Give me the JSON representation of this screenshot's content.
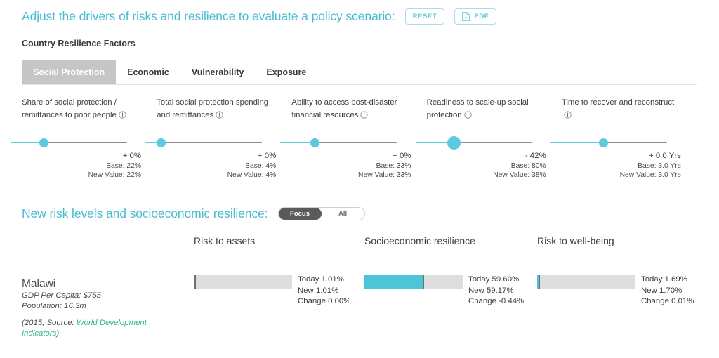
{
  "header": {
    "title": "Adjust the drivers of risks and resilience to evaluate a policy scenario:",
    "reset_label": "RESET",
    "pdf_label": "PDF",
    "reset_icon": "reset-icon",
    "pdf_icon": "pdf-download-icon",
    "accent_color": "#49bcd3"
  },
  "factors_section": {
    "label": "Country Resilience Factors",
    "tabs": [
      {
        "label": "Social Protection",
        "active": true
      },
      {
        "label": "Economic",
        "active": false
      },
      {
        "label": "Vulnerability",
        "active": false
      },
      {
        "label": "Exposure",
        "active": false
      }
    ]
  },
  "sliders": [
    {
      "label": "Share of social protection / remittances to poor people",
      "info_icon": "info-icon",
      "delta": "+ 0%",
      "base": "Base: 22%",
      "new_value": "New Value: 22%",
      "thumb_pct": 18,
      "thumb_size": 13
    },
    {
      "label": "Total social protection spending and remittances",
      "info_icon": "info-icon",
      "delta": "+ 0%",
      "base": "Base: 4%",
      "new_value": "New Value: 4%",
      "thumb_pct": 0,
      "thumb_size": 13
    },
    {
      "label": "Ability to access post-disaster financial resources",
      "info_icon": "info-icon",
      "delta": "+ 0%",
      "base": "Base: 33%",
      "new_value": "New Value: 33%",
      "thumb_pct": 19,
      "thumb_size": 13
    },
    {
      "label": "Readiness to scale-up social protection",
      "info_icon": "info-icon",
      "delta": "- 42%",
      "base": "Base: 80%",
      "new_value": "New Value: 38%",
      "thumb_pct": 23,
      "thumb_size": 19
    },
    {
      "label": "Time to recover and reconstruct",
      "info_icon": "info-icon",
      "delta": "+ 0.0 Yrs",
      "base": "Base: 3.0 Yrs",
      "new_value": "New Value: 3.0 Yrs",
      "thumb_pct": 37,
      "thumb_size": 13
    }
  ],
  "results_section": {
    "title": "New risk levels and socioeconomic resilience:",
    "toggle": {
      "focus_label": "Focus",
      "all_label": "All",
      "selected": "Focus"
    },
    "columns": [
      {
        "label": "Risk to assets"
      },
      {
        "label": "Socioeconomic resilience"
      },
      {
        "label": "Risk to well-being"
      }
    ]
  },
  "country": {
    "name": "Malawi",
    "gdp": "GDP Per Capita: $755",
    "population": "Population: 16.3m",
    "source_prefix": "(2015, Source: ",
    "source_link": "World Development Indicators",
    "source_suffix": ")",
    "link_color": "#2fb783"
  },
  "chart_data": {
    "type": "bar",
    "title": "New risk levels and socioeconomic resilience",
    "categories": [
      "Risk to assets",
      "Socioeconomic resilience",
      "Risk to well-being"
    ],
    "series": [
      {
        "name": "Today",
        "values": [
          1.01,
          59.6,
          1.69
        ]
      },
      {
        "name": "New",
        "values": [
          1.01,
          59.17,
          1.7
        ]
      },
      {
        "name": "Change",
        "values": [
          0.0,
          -0.44,
          0.01
        ]
      }
    ],
    "ylim": [
      0,
      100
    ],
    "unit": "%",
    "grid": false,
    "legend": "none",
    "bars": [
      {
        "category": "Risk to assets",
        "fill_pct": 1.01,
        "marker_pct": 1.01,
        "today_label": "Today 1.01%",
        "new_label": "New 1.01%",
        "change_label": "Change 0.00%"
      },
      {
        "category": "Socioeconomic resilience",
        "fill_pct": 59.17,
        "marker_pct": 59.6,
        "today_label": "Today 59.60%",
        "new_label": "New 59.17%",
        "change_label": "Change -0.44%"
      },
      {
        "category": "Risk to well-being",
        "fill_pct": 1.7,
        "marker_pct": 1.69,
        "today_label": "Today 1.69%",
        "new_label": "New 1.70%",
        "change_label": "Change 0.01%"
      }
    ],
    "bar_color": "#4cc5d8",
    "track_color": "#dedede",
    "marker_color": "#6e6e6e"
  }
}
